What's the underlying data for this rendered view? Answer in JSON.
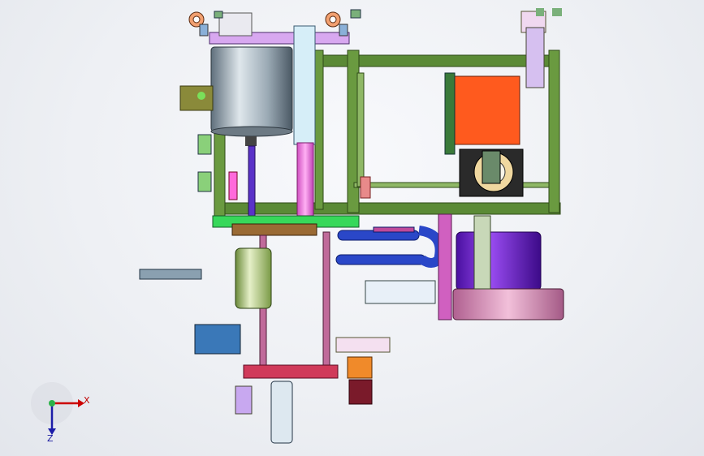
{
  "triad": {
    "x_label": "X",
    "z_label": "Z",
    "x_color": "#cc0000",
    "z_color": "#1c1ca8",
    "origin_color": "#2bb24a"
  },
  "colors": {
    "frame_green": "#5b8a36",
    "orange_block": "#ff5a1e",
    "magenta": "#e86ad8",
    "blue_chain": "#2a47c8",
    "purple_drum": "#7a22e6",
    "pink_base": "#d98fb4",
    "cylinder_gray": "#b8c4cc",
    "brown_plate": "#8a5a2a"
  }
}
